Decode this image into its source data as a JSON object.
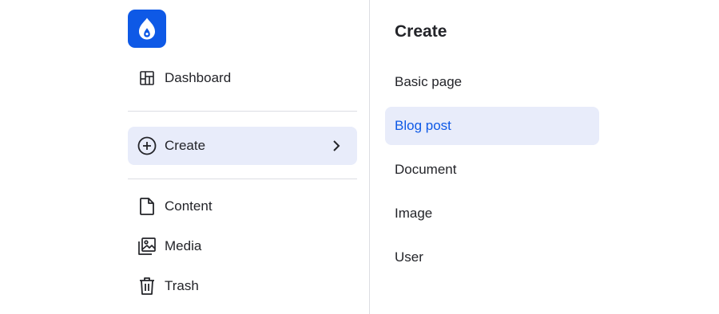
{
  "sidebar": {
    "logo_name": "drupal-drop-icon",
    "items": [
      {
        "label": "Dashboard",
        "icon": "dashboard-grid-icon"
      },
      {
        "label": "Create",
        "icon": "plus-circle-icon",
        "active": true,
        "has_submenu": true
      },
      {
        "label": "Content",
        "icon": "file-icon"
      },
      {
        "label": "Media",
        "icon": "media-images-icon"
      },
      {
        "label": "Trash",
        "icon": "trash-icon"
      }
    ]
  },
  "submenu": {
    "title": "Create",
    "items": [
      {
        "label": "Basic page"
      },
      {
        "label": "Blog post",
        "active": true
      },
      {
        "label": "Document"
      },
      {
        "label": "Image"
      },
      {
        "label": "User"
      }
    ]
  },
  "colors": {
    "brand": "#0e59e6",
    "active_bg": "#e8ecfa",
    "text": "#232429",
    "divider": "#dcdee3"
  }
}
